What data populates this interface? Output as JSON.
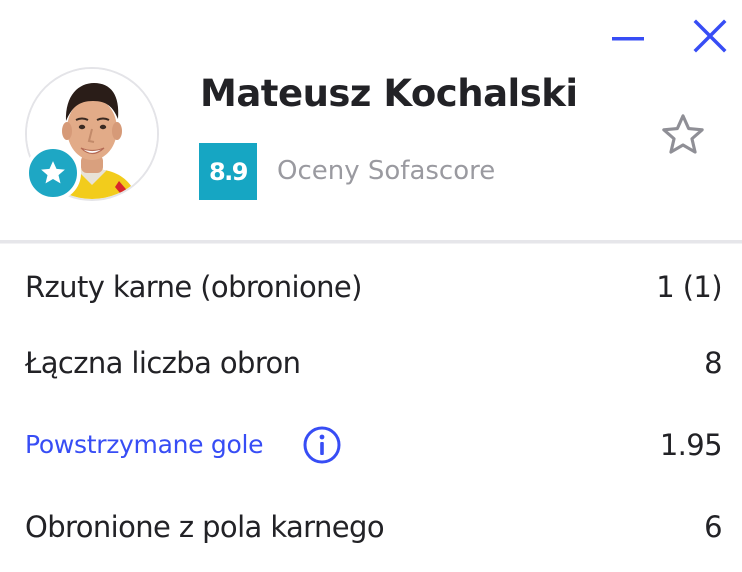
{
  "window": {
    "minimize_icon": "minimize-icon",
    "close_icon": "close-icon",
    "accent_color": "#374df5"
  },
  "player": {
    "name": "Mateusz Kochalski",
    "rating": "8.9",
    "rating_label": "Oceny Sofascore",
    "rating_color": "#16a6c3",
    "badge_icon": "star-icon",
    "favorite_icon": "star-outline-icon"
  },
  "stats": [
    {
      "label": "Rzuty karne (obronione)",
      "value": "1 (1)"
    },
    {
      "label": "Łączna liczba obron",
      "value": "8"
    },
    {
      "label": "Powstrzymane gole",
      "value": "1.95",
      "info_icon": "info-icon"
    },
    {
      "label": "Obronione z pola karnego",
      "value": "6"
    }
  ]
}
